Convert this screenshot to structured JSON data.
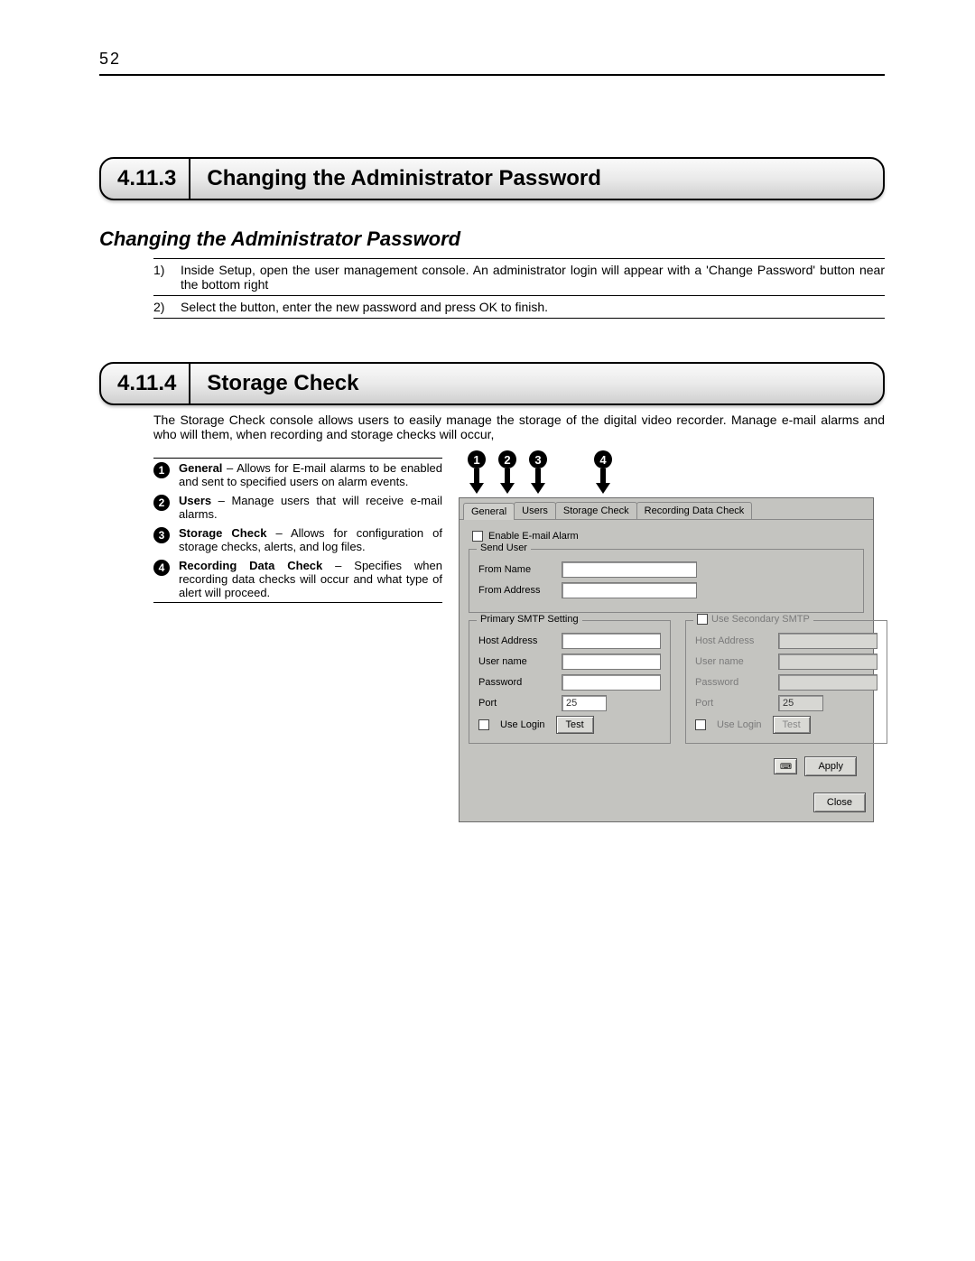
{
  "page_number": "52",
  "section1": {
    "num": "4.11.3",
    "title": "Changing the Administrator Password",
    "subhead": "Changing the Administrator Password",
    "steps": [
      {
        "n": "1)",
        "t": "Inside Setup, open the user management console. An administrator login will appear with a 'Change Password' button near the bottom right"
      },
      {
        "n": "2)",
        "t": "Select the button, enter the new password and press OK to finish."
      }
    ]
  },
  "section2": {
    "num": "4.11.4",
    "title": "Storage Check",
    "intro": "The Storage Check console allows users to easily manage the storage of the digital video recorder. Manage e-mail alarms and who will them, when recording and storage checks will occur,",
    "legend": [
      {
        "b": "General",
        "t": " – Allows for E-mail alarms to be enabled and sent to specified users on alarm events."
      },
      {
        "b": "Users",
        "t": " – Manage users that will receive e-mail alarms."
      },
      {
        "b": "Storage Check",
        "t": " – Allows for configuration of storage checks, alerts, and log files."
      },
      {
        "b": "Recording Data Check",
        "t": " – Specifies when recording data checks will occur and what type of alert will proceed."
      }
    ],
    "arrows": [
      "1",
      "2",
      "3",
      "4"
    ]
  },
  "dialog": {
    "tabs": [
      "General",
      "Users",
      "Storage Check",
      "Recording Data Check"
    ],
    "enable_email": "Enable E-mail Alarm",
    "send_user": {
      "title": "Send User",
      "from_name": "From Name",
      "from_address": "From Address"
    },
    "primary": {
      "title": "Primary SMTP Setting",
      "host": "Host Address",
      "user": "User name",
      "pass": "Password",
      "port": "Port",
      "port_val": "25",
      "use_login": "Use Login",
      "test": "Test"
    },
    "secondary": {
      "title_chk": "Use Secondary SMTP",
      "host": "Host Address",
      "user": "User name",
      "pass": "Password",
      "port": "Port",
      "port_val": "25",
      "use_login": "Use Login",
      "test": "Test"
    },
    "apply": "Apply",
    "close": "Close"
  }
}
